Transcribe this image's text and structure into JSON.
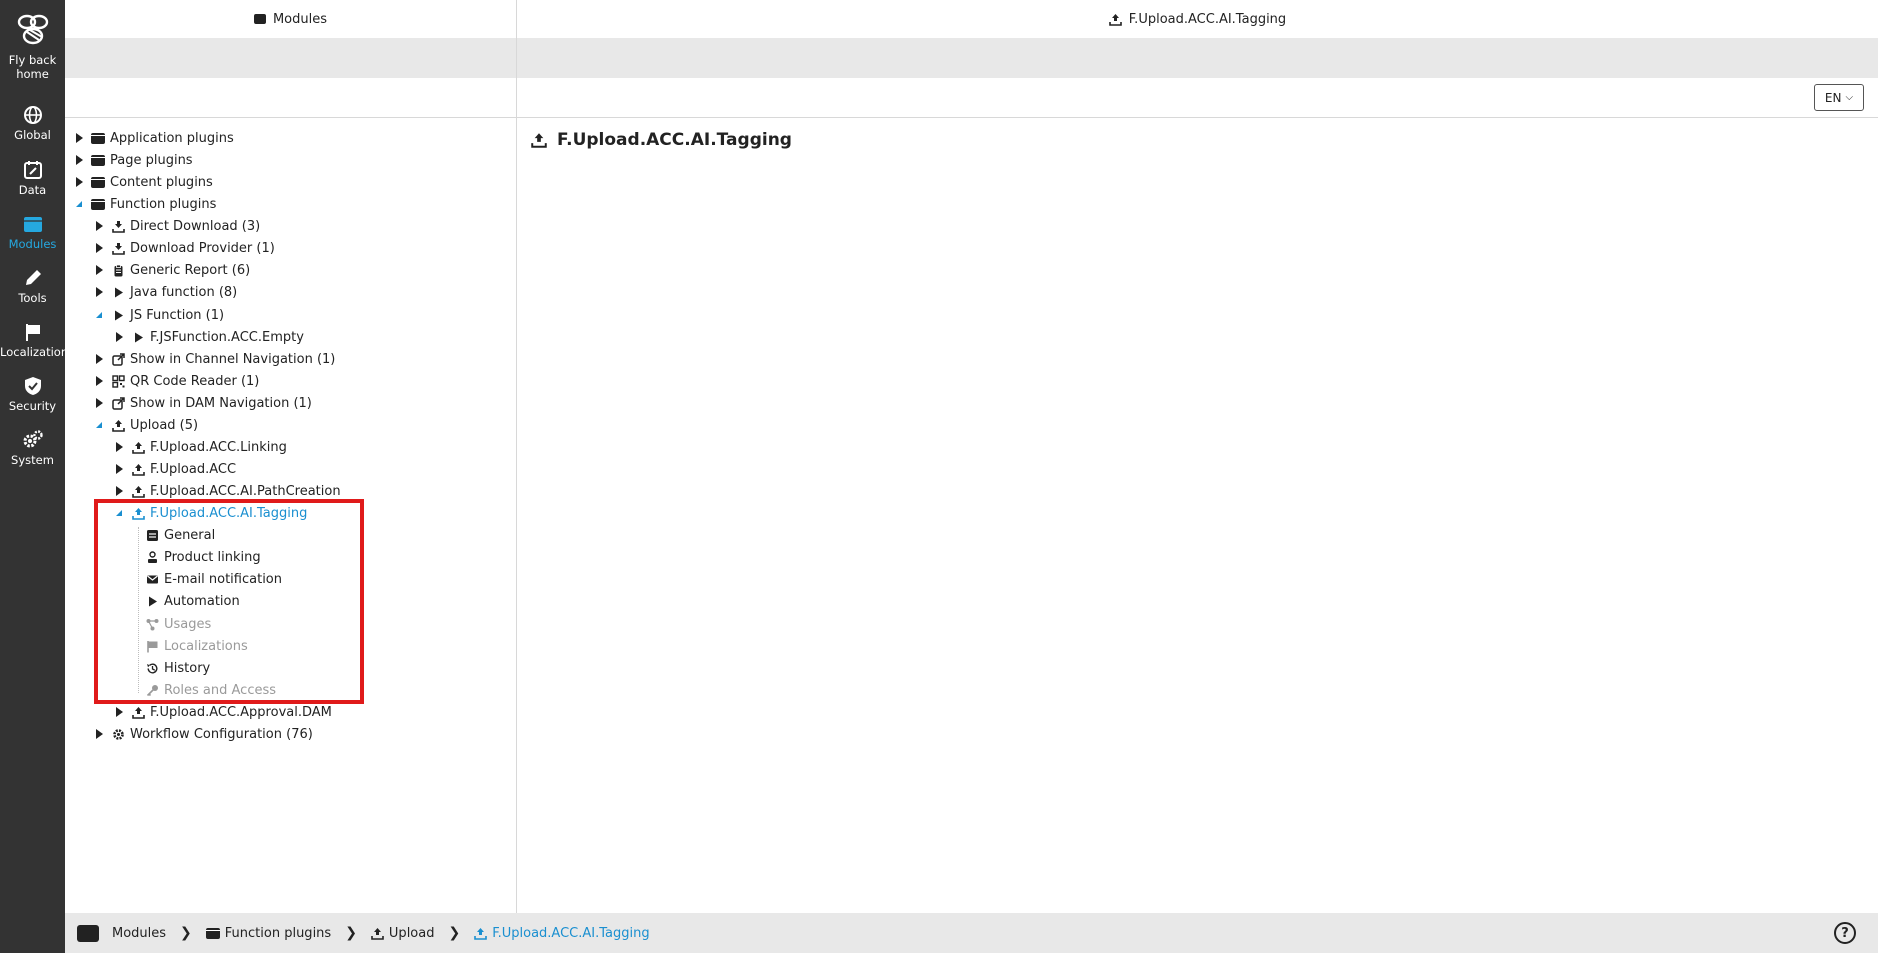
{
  "rail": {
    "home": "Fly back home",
    "items": [
      "Global",
      "Data",
      "Modules",
      "Tools",
      "Localization",
      "Security",
      "System"
    ],
    "active": "Modules"
  },
  "left_panel": {
    "title": "Modules"
  },
  "right_panel": {
    "title": "F.Upload.ACC.AI.Tagging",
    "lang": "EN",
    "detail_title": "F.Upload.ACC.AI.Tagging"
  },
  "tree": [
    {
      "label": "Application plugins",
      "level": 0,
      "toggle": "collapsed",
      "icon": "plugin-icon"
    },
    {
      "label": "Page plugins",
      "level": 0,
      "toggle": "collapsed",
      "icon": "plugin-icon"
    },
    {
      "label": "Content plugins",
      "level": 0,
      "toggle": "collapsed",
      "icon": "plugin-icon"
    },
    {
      "label": "Function plugins",
      "level": 0,
      "toggle": "expanded",
      "icon": "plugin-icon"
    },
    {
      "label": "Direct Download (3)",
      "level": 1,
      "toggle": "collapsed",
      "icon": "download-icon"
    },
    {
      "label": "Download Provider (1)",
      "level": 1,
      "toggle": "collapsed",
      "icon": "download-icon"
    },
    {
      "label": "Generic Report (6)",
      "level": 1,
      "toggle": "collapsed",
      "icon": "clipboard-icon"
    },
    {
      "label": "Java function (8)",
      "level": 1,
      "toggle": "collapsed",
      "icon": "play-icon"
    },
    {
      "label": "JS Function (1)",
      "level": 1,
      "toggle": "expanded",
      "icon": "play-icon"
    },
    {
      "label": "F.JSFunction.ACC.Empty",
      "level": 2,
      "toggle": "collapsed",
      "icon": "play-icon"
    },
    {
      "label": "Show in Channel Navigation (1)",
      "level": 1,
      "toggle": "collapsed",
      "icon": "share-icon"
    },
    {
      "label": "QR Code Reader (1)",
      "level": 1,
      "toggle": "collapsed",
      "icon": "qrcode-icon"
    },
    {
      "label": "Show in DAM Navigation (1)",
      "level": 1,
      "toggle": "collapsed",
      "icon": "share-icon"
    },
    {
      "label": "Upload (5)",
      "level": 1,
      "toggle": "expanded",
      "icon": "upload-icon"
    },
    {
      "label": "F.Upload.ACC.Linking",
      "level": 2,
      "toggle": "collapsed",
      "icon": "upload-icon"
    },
    {
      "label": "F.Upload.ACC",
      "level": 2,
      "toggle": "collapsed",
      "icon": "upload-icon"
    },
    {
      "label": "F.Upload.ACC.AI.PathCreation",
      "level": 2,
      "toggle": "collapsed",
      "icon": "upload-icon"
    },
    {
      "label": "F.Upload.ACC.AI.Tagging",
      "level": 2,
      "toggle": "expanded",
      "icon": "upload-icon",
      "selected": true
    },
    {
      "label": "General",
      "level": 3,
      "toggle": "none",
      "icon": "form-icon"
    },
    {
      "label": "Product linking",
      "level": 3,
      "toggle": "none",
      "icon": "product-icon"
    },
    {
      "label": "E-mail notification",
      "level": 3,
      "toggle": "none",
      "icon": "mail-icon"
    },
    {
      "label": "Automation",
      "level": 3,
      "toggle": "none",
      "icon": "play-icon"
    },
    {
      "label": "Usages",
      "level": 3,
      "toggle": "none",
      "icon": "usages-icon",
      "disabled": true
    },
    {
      "label": "Localizations",
      "level": 3,
      "toggle": "none",
      "icon": "flag-icon",
      "disabled": true
    },
    {
      "label": "History",
      "level": 3,
      "toggle": "none",
      "icon": "history-icon"
    },
    {
      "label": "Roles and Access",
      "level": 3,
      "toggle": "none",
      "icon": "key-icon",
      "disabled": true
    },
    {
      "label": "F.Upload.ACC.Approval.DAM",
      "level": 2,
      "toggle": "collapsed",
      "icon": "upload-icon"
    },
    {
      "label": "Workflow Configuration (76)",
      "level": 1,
      "toggle": "collapsed",
      "icon": "gear-icon"
    }
  ],
  "breadcrumb": [
    {
      "label": "Modules",
      "icon": "modules-icon"
    },
    {
      "label": "Function plugins",
      "icon": "plugin-icon"
    },
    {
      "label": "Upload",
      "icon": "upload-icon"
    },
    {
      "label": "F.Upload.ACC.AI.Tagging",
      "icon": "upload-icon",
      "current": true
    }
  ],
  "help": "?",
  "colors": {
    "rail_bg": "#333333",
    "accent": "#1a8fd0",
    "highlight": "#e01a1a"
  }
}
